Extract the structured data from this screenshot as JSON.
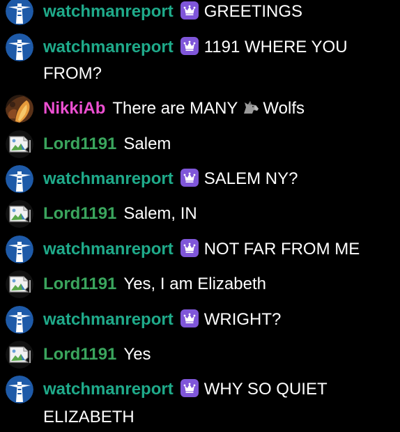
{
  "colors": {
    "watchman": "#1faa8a",
    "nikki": "#ec4fd1",
    "lord": "#3aa55d",
    "badge": "#7f56d9",
    "background": "#000000",
    "text": "#ffffff"
  },
  "messages": [
    {
      "user": "watchmanreport",
      "badge": "crown-badge-icon",
      "avatar": "lighthouse-avatar",
      "text": "GREETINGS"
    },
    {
      "user": "watchmanreport",
      "badge": "crown-badge-icon",
      "avatar": "lighthouse-avatar",
      "text": "1191 WHERE YOU",
      "text2": "FROM?"
    },
    {
      "user": "NikkiAb",
      "avatar": "photo-avatar",
      "text_before": "There are MANY",
      "emoji": "wolf-emoji-icon",
      "text_after": "Wolfs"
    },
    {
      "user": "Lord1191",
      "avatar": "broken-image-avatar",
      "text": "Salem"
    },
    {
      "user": "watchmanreport",
      "badge": "crown-badge-icon",
      "avatar": "lighthouse-avatar",
      "text": "SALEM NY?"
    },
    {
      "user": "Lord1191",
      "avatar": "broken-image-avatar",
      "text": "Salem, IN"
    },
    {
      "user": "watchmanreport",
      "badge": "crown-badge-icon",
      "avatar": "lighthouse-avatar",
      "text": "NOT FAR FROM ME"
    },
    {
      "user": "Lord1191",
      "avatar": "broken-image-avatar",
      "text": "Yes, I am Elizabeth"
    },
    {
      "user": "watchmanreport",
      "badge": "crown-badge-icon",
      "avatar": "lighthouse-avatar",
      "text": "WRIGHT?"
    },
    {
      "user": "Lord1191",
      "avatar": "broken-image-avatar",
      "text": "Yes"
    },
    {
      "user": "watchmanreport",
      "badge": "crown-badge-icon",
      "avatar": "lighthouse-avatar",
      "text": "WHY SO QUIET",
      "text2": "ELIZABETH"
    }
  ]
}
